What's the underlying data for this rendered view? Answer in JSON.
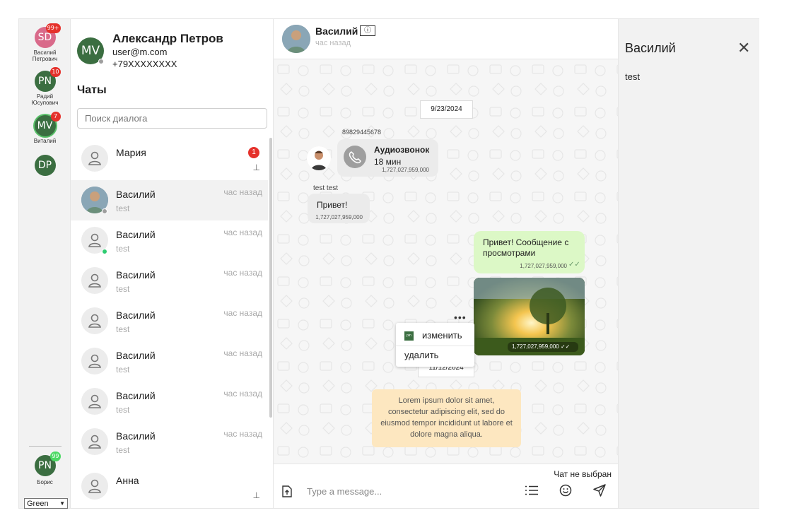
{
  "rail": {
    "contacts": [
      {
        "initials": "SD",
        "badge": "99+",
        "name": "Василий Петрович"
      },
      {
        "initials": "PN",
        "badge": "10",
        "name": "Радий Юсупович"
      },
      {
        "initials": "MV",
        "badge": "7",
        "name": "Виталий"
      },
      {
        "initials": "DP",
        "badge": "",
        "name": ""
      }
    ],
    "bottom_contact": {
      "initials": "PN",
      "badge": "99",
      "name": "Борис"
    },
    "theme": "Green"
  },
  "profile": {
    "initials": "MV",
    "name": "Александр Петров",
    "email": "user@m.com",
    "phone": "+79XXXXXXXX"
  },
  "chat_list": {
    "title": "Чаты",
    "search_placeholder": "Поиск диалога",
    "items": [
      {
        "name": "Мария",
        "preview": "",
        "time": "",
        "unread": "1",
        "pinned": true
      },
      {
        "name": "Василий",
        "preview": "test",
        "time": "час назад"
      },
      {
        "name": "Василий",
        "preview": "test",
        "time": "час назад"
      },
      {
        "name": "Василий",
        "preview": "test",
        "time": "час назад"
      },
      {
        "name": "Василий",
        "preview": "test",
        "time": "час назад"
      },
      {
        "name": "Василий",
        "preview": "test",
        "time": "час назад"
      },
      {
        "name": "Василий",
        "preview": "test",
        "time": "час назад"
      },
      {
        "name": "Василий",
        "preview": "test",
        "time": "час назад"
      },
      {
        "name": "Анна",
        "preview": "",
        "time": "",
        "pinned": true
      }
    ]
  },
  "conversation": {
    "header": {
      "name": "Василий",
      "status": "час назад"
    },
    "date1": "9/23/2024",
    "caller_phone": "89829445678",
    "call": {
      "title": "Аудиозвонок",
      "duration": "18 мин",
      "time": "1,727,027,959,000"
    },
    "sender_label": "test test",
    "incoming": {
      "text": "Привет!",
      "time": "1,727,027,959,000"
    },
    "outgoing": {
      "text": "Привет! Сообщение с просмотрами",
      "time": "1,727,027,959,000"
    },
    "image_time": "1,727,027,959,000",
    "context_menu": {
      "edit": "изменить",
      "delete": "удалить",
      "edit_icon_text": "pin"
    },
    "date2": "11/12/2024",
    "system_text": "Lorem ipsum dolor sit amet, consectetur adipiscing elit, sed do eiusmod tempor incididunt ut labore et dolore magna aliqua.",
    "composer": {
      "status": "Чат не выбран",
      "placeholder": "Type a message..."
    }
  },
  "info_panel": {
    "title": "Василий",
    "text": "test"
  },
  "colors": {
    "accent_green": "#3b6e41",
    "badge_red": "#e5312b",
    "outgoing_bubble": "#dcf8c6",
    "system_bubble": "#fde7c0"
  }
}
